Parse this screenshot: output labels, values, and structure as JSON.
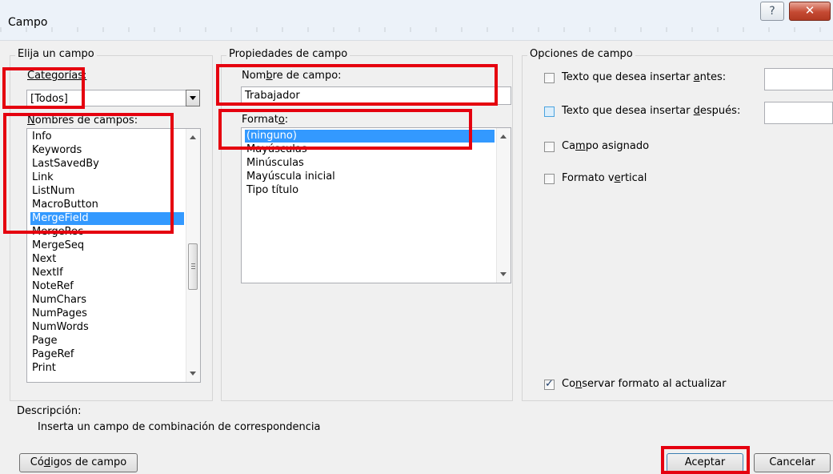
{
  "dialog": {
    "title": "Campo"
  },
  "left_panel": {
    "group_label": "Elija un campo",
    "categories_label": "Categorías:",
    "categories_value": "[Todos]",
    "field_names_label": "Nombres de campos:",
    "field_names": [
      "Info",
      "Keywords",
      "LastSavedBy",
      "Link",
      "ListNum",
      "MacroButton",
      "MergeField",
      "MergeRec",
      "MergeSeq",
      "Next",
      "NextIf",
      "NoteRef",
      "NumChars",
      "NumPages",
      "NumWords",
      "Page",
      "PageRef",
      "Print"
    ],
    "selected_field": "MergeField"
  },
  "middle_panel": {
    "group_label": "Propiedades de campo",
    "field_name_label": "Nombre de campo:",
    "field_name_value": "Trabajador",
    "format_label": "Formato:",
    "formats": [
      "(ninguno)",
      "Mayúsculas",
      "Minúsculas",
      "Mayúscula inicial",
      "Tipo título"
    ],
    "selected_format": "(ninguno)"
  },
  "right_panel": {
    "group_label": "Opciones de campo",
    "options": [
      {
        "label": "Texto que desea insertar antes:",
        "checked": false
      },
      {
        "label": "Texto que desea insertar después:",
        "checked": false
      },
      {
        "label": "Campo asignado",
        "checked": false
      },
      {
        "label": "Formato vertical",
        "checked": false
      }
    ],
    "preserve_format": {
      "label": "Conservar formato al actualizar",
      "checked": true
    }
  },
  "description": {
    "label": "Descripción:",
    "text": "Inserta un campo de combinación de correspondencia"
  },
  "buttons": {
    "field_codes": "Códigos de campo",
    "ok": "Aceptar",
    "cancel": "Cancelar"
  },
  "colors": {
    "highlight": "#e5000f",
    "selection": "#3399ff"
  }
}
